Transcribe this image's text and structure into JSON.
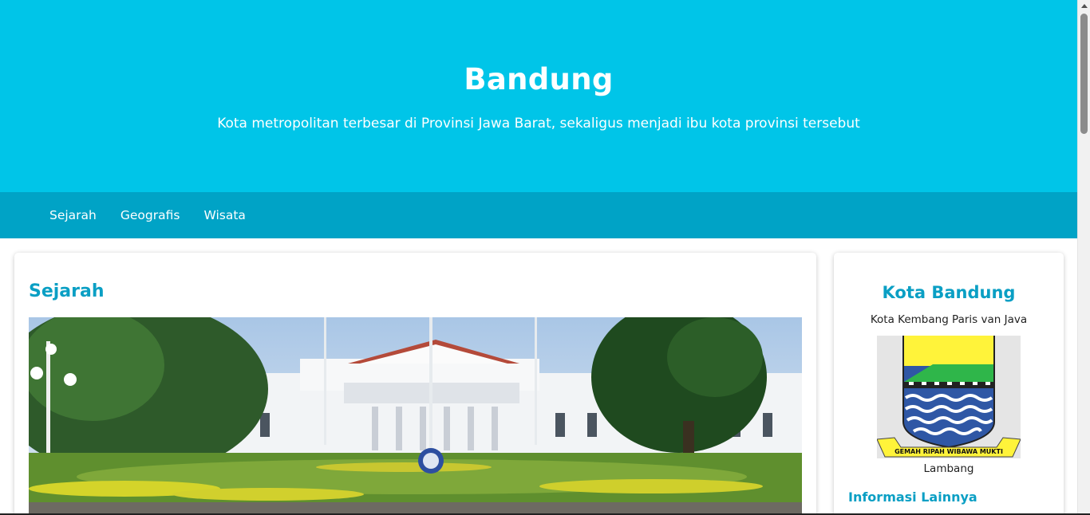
{
  "hero": {
    "title": "Bandung",
    "subtitle": "Kota metropolitan terbesar di Provinsi Jawa Barat, sekaligus menjadi ibu kota provinsi tersebut"
  },
  "nav": {
    "items": [
      {
        "label": "Sejarah"
      },
      {
        "label": "Geografis"
      },
      {
        "label": "Wisata"
      }
    ]
  },
  "main": {
    "heading": "Sejarah"
  },
  "sidebar": {
    "title": "Kota Bandung",
    "tagline": "Kota Kembang Paris van Java",
    "emblem_motto": "GEMAH RIPAH WIBAWA MUKTI",
    "emblem_caption": "Lambang",
    "more_heading": "Informasi Lainnya"
  },
  "colors": {
    "hero_bg": "#00c5e8",
    "nav_bg": "#00a3c6",
    "accent_heading": "#0a9fc4"
  }
}
